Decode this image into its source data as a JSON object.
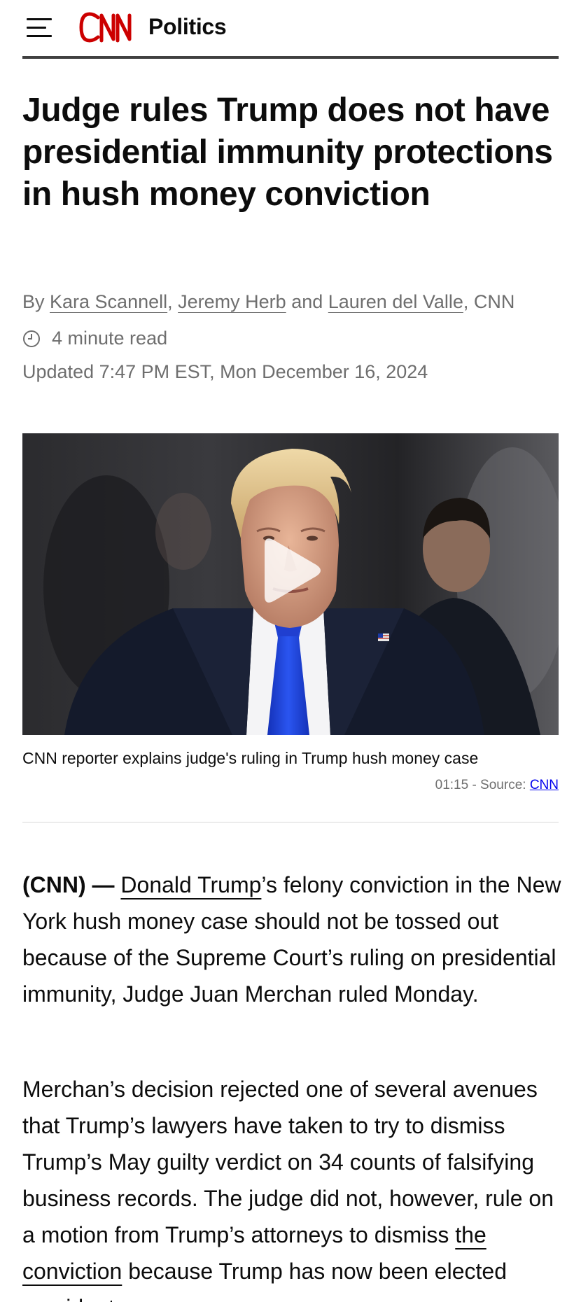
{
  "header": {
    "logo_text": "CNN",
    "section": "Politics",
    "menu_icon": "hamburger-menu-icon"
  },
  "article": {
    "headline": "Judge rules Trump does not have presidential immunity protections in hush money conviction",
    "byline": {
      "prefix": "By ",
      "authors": [
        "Kara Scannell",
        "Jeremy Herb",
        "Lauren del Valle"
      ],
      "sep1": ", ",
      "sep2": " and ",
      "suffix": ", CNN"
    },
    "read_time": "4 minute read",
    "clock_icon": "clock-icon",
    "updated": "Updated 7:47 PM EST, Mon December 16, 2024",
    "video": {
      "play_icon": "play-icon",
      "caption": "CNN reporter explains judge's ruling in Trump hush money case",
      "duration_source": "01:15 - Source: ",
      "source_link": "CNN"
    },
    "paragraphs": [
      {
        "dateline": "(CNN) — ",
        "link1": "Donald Trump",
        "text1": "’s felony conviction in the New York hush money case should not be tossed out because of the Supreme Court’s ruling on presidential immunity, Judge Juan Merchan ruled Monday."
      },
      {
        "text1": "Merchan’s decision rejected one of several avenues that Trump’s lawyers have taken to try to dismiss Trump’s May guilty verdict on 34 counts of falsifying business records. The judge did not, however, rule on a motion from Trump’s attorneys to dismiss ",
        "link1": "the conviction",
        "text2": " because Trump has now been elected president."
      }
    ]
  },
  "colors": {
    "cnn_red": "#cc0000",
    "text": "#0c0c0c",
    "meta": "#6e6e6e",
    "tie_blue": "#1e40d6"
  }
}
